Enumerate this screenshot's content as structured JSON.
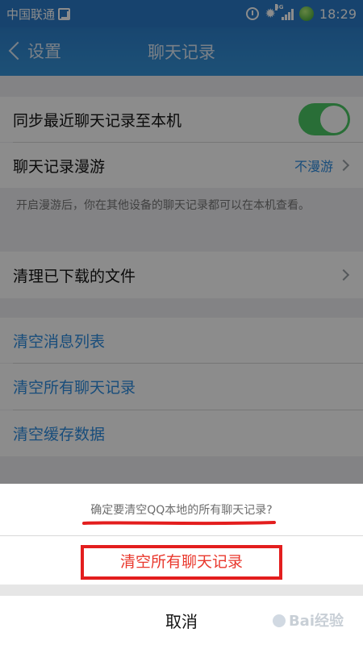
{
  "status_bar": {
    "carrier": "中国联通",
    "network": "3G",
    "time": "18:29"
  },
  "navbar": {
    "back_label": "设置",
    "title": "聊天记录"
  },
  "settings": {
    "sync_label": "同步最近聊天记录至本机",
    "sync_enabled": true,
    "roaming_label": "聊天记录漫游",
    "roaming_value": "不漫游",
    "roaming_note": "开启漫游后，你在其他设备的聊天记录都可以在本机查看。",
    "clean_files_label": "清理已下载的文件",
    "clear_messages_label": "清空消息列表",
    "clear_all_label": "清空所有聊天记录",
    "clear_cache_label": "清空缓存数据"
  },
  "action_sheet": {
    "prompt": "确定要清空QQ本地的所有聊天记录?",
    "confirm_label": "清空所有聊天记录",
    "cancel_label": "取消"
  },
  "watermark": {
    "text": "Bai经验"
  },
  "colors": {
    "navbar": "#2d80cc",
    "accent": "#2d8ce0",
    "toggle_on": "#4cc864",
    "destructive": "#e9382d",
    "annotation": "#e31e1e"
  }
}
